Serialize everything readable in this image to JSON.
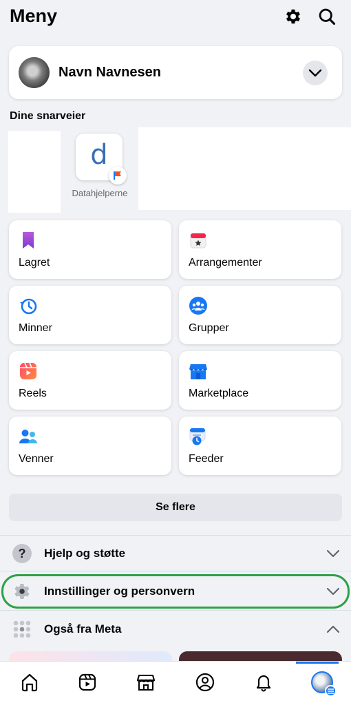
{
  "header": {
    "title": "Meny",
    "icons": [
      "gear-icon",
      "search-icon"
    ]
  },
  "profile": {
    "name": "Navn Navnesen"
  },
  "shortcuts": {
    "label": "Dine snarveier",
    "items": [
      {
        "letter": "d",
        "name": "Datahjelperne"
      }
    ]
  },
  "grid": [
    {
      "label": "Lagret",
      "icon": "bookmark-icon"
    },
    {
      "label": "Arrangementer",
      "icon": "calendar-icon"
    },
    {
      "label": "Minner",
      "icon": "memories-icon"
    },
    {
      "label": "Grupper",
      "icon": "groups-icon"
    },
    {
      "label": "Reels",
      "icon": "reels-icon"
    },
    {
      "label": "Marketplace",
      "icon": "marketplace-icon"
    },
    {
      "label": "Venner",
      "icon": "friends-icon"
    },
    {
      "label": "Feeder",
      "icon": "feeds-icon"
    }
  ],
  "see_more": "Se flere",
  "rows": {
    "help": {
      "label": "Hjelp og støtte",
      "icon": "help-icon"
    },
    "settings": {
      "label": "Innstillinger og personvern",
      "icon": "settings-gear-icon"
    },
    "meta": {
      "label": "Også fra Meta",
      "icon": "apps-grid-icon"
    }
  },
  "bottom_nav": [
    "home-icon",
    "video-icon",
    "marketplace-icon",
    "profile-icon",
    "notifications-icon",
    "menu-avatar-icon"
  ],
  "colors": {
    "accent": "#1877f2",
    "highlight": "#2aa345",
    "background": "#f1f2f6"
  }
}
